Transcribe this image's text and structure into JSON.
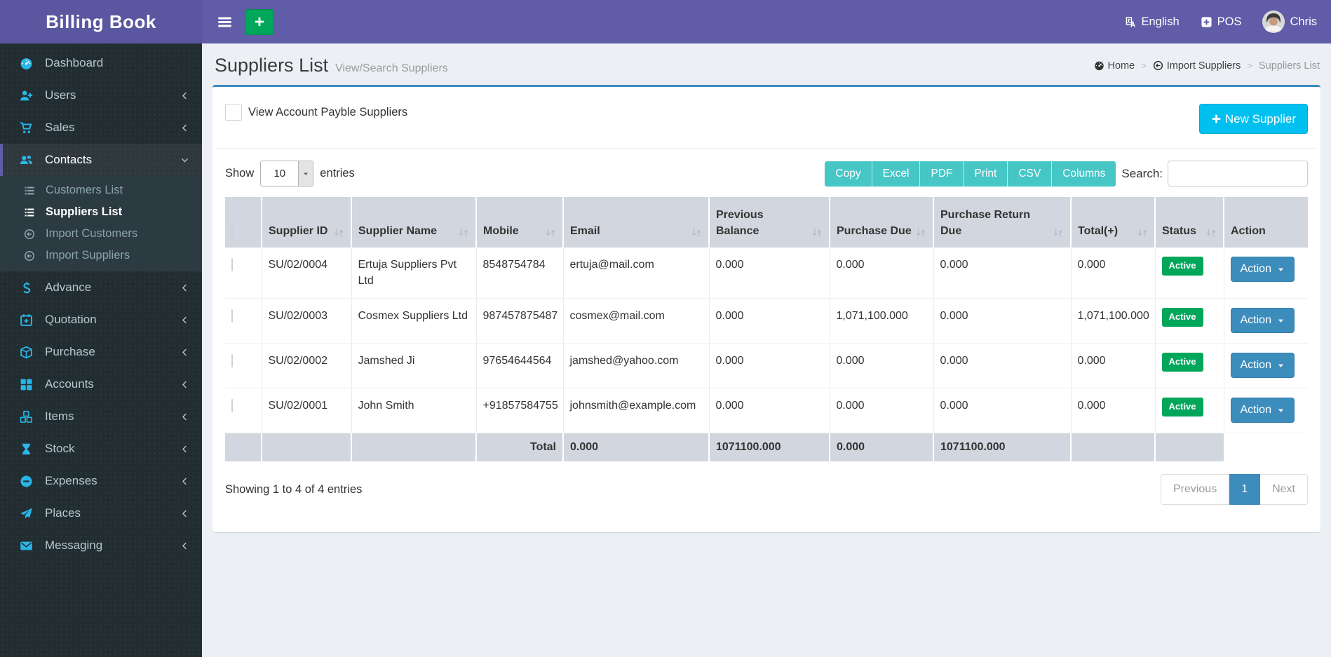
{
  "brand": {
    "title": "Billing Book"
  },
  "navbar": {
    "language": "English",
    "pos": "POS",
    "user": "Chris"
  },
  "sidebar": {
    "items": [
      {
        "label": "Dashboard",
        "icon": "gauge",
        "chevron": null,
        "active": false
      },
      {
        "label": "Users",
        "icon": "user-plus",
        "chevron": "left",
        "active": false
      },
      {
        "label": "Sales",
        "icon": "cart",
        "chevron": "left",
        "active": false
      },
      {
        "label": "Contacts",
        "icon": "users",
        "chevron": "down",
        "active": true,
        "children": [
          {
            "label": "Customers List",
            "icon": "list",
            "active": false
          },
          {
            "label": "Suppliers List",
            "icon": "list",
            "active": true
          },
          {
            "label": "Import Customers",
            "icon": "import",
            "active": false
          },
          {
            "label": "Import Suppliers",
            "icon": "import",
            "active": false
          }
        ]
      },
      {
        "label": "Advance",
        "icon": "dollar",
        "chevron": "left",
        "active": false
      },
      {
        "label": "Quotation",
        "icon": "calendar-plus",
        "chevron": "left",
        "active": false
      },
      {
        "label": "Purchase",
        "icon": "cube",
        "chevron": "left",
        "active": false
      },
      {
        "label": "Accounts",
        "icon": "grid",
        "chevron": "left",
        "active": false
      },
      {
        "label": "Items",
        "icon": "cubes",
        "chevron": "left",
        "active": false
      },
      {
        "label": "Stock",
        "icon": "hourglass",
        "chevron": "left",
        "active": false
      },
      {
        "label": "Expenses",
        "icon": "minus-circle",
        "chevron": "left",
        "active": false
      },
      {
        "label": "Places",
        "icon": "paper-plane",
        "chevron": "left",
        "active": false
      },
      {
        "label": "Messaging",
        "icon": "envelope",
        "chevron": "left",
        "active": false
      }
    ]
  },
  "page": {
    "title": "Suppliers List",
    "subtitle": "View/Search Suppliers",
    "breadcrumb": [
      {
        "label": "Home",
        "icon": "gauge",
        "current": false
      },
      {
        "label": "Import Suppliers",
        "icon": "import",
        "current": false
      },
      {
        "label": "Suppliers List",
        "icon": null,
        "current": true
      }
    ]
  },
  "main": {
    "filter_label": "View Account Payble Suppliers",
    "new_supplier_label": "New Supplier",
    "show_label": "Show",
    "page_size": "10",
    "entries_label": "entries",
    "export_buttons": [
      "Copy",
      "Excel",
      "PDF",
      "Print",
      "CSV",
      "Columns"
    ],
    "search_label": "Search:",
    "search_value": "",
    "table": {
      "columns": [
        {
          "label": "Supplier ID",
          "key": "id",
          "sortable": true
        },
        {
          "label": "Supplier Name",
          "key": "name",
          "sortable": true
        },
        {
          "label": "Mobile",
          "key": "mobile",
          "sortable": true
        },
        {
          "label": "Email",
          "key": "email",
          "sortable": true
        },
        {
          "label": "Previous Balance",
          "key": "prev",
          "sortable": true
        },
        {
          "label": "Purchase Due",
          "key": "due",
          "sortable": true
        },
        {
          "label": "Purchase Return Due",
          "key": "ret",
          "sortable": true
        },
        {
          "label": "Total(+)",
          "key": "total",
          "sortable": true
        },
        {
          "label": "Status",
          "key": "status",
          "sortable": true
        },
        {
          "label": "Action",
          "key": "action",
          "sortable": false
        }
      ],
      "rows": [
        {
          "id": "SU/02/0004",
          "name": "Ertuja Suppliers Pvt Ltd",
          "mobile": "8548754784",
          "email": "ertuja@mail.com",
          "prev": "0.000",
          "due": "0.000",
          "ret": "0.000",
          "total": "0.000",
          "status": "Active",
          "action": "Action"
        },
        {
          "id": "SU/02/0003",
          "name": "Cosmex Suppliers Ltd",
          "mobile": "987457875487",
          "email": "cosmex@mail.com",
          "prev": "0.000",
          "due": "1,071,100.000",
          "ret": "0.000",
          "total": "1,071,100.000",
          "status": "Active",
          "action": "Action"
        },
        {
          "id": "SU/02/0002",
          "name": "Jamshed Ji",
          "mobile": "97654644564",
          "email": "jamshed@yahoo.com",
          "prev": "0.000",
          "due": "0.000",
          "ret": "0.000",
          "total": "0.000",
          "status": "Active",
          "action": "Action"
        },
        {
          "id": "SU/02/0001",
          "name": "John Smith",
          "mobile": "+91857584755",
          "email": "johnsmith@example.com",
          "prev": "0.000",
          "due": "0.000",
          "ret": "0.000",
          "total": "0.000",
          "status": "Active",
          "action": "Action"
        }
      ],
      "footer": {
        "label": "Total",
        "prev": "0.000",
        "due": "1071100.000",
        "ret": "0.000",
        "total": "1071100.000"
      }
    },
    "info_text": "Showing 1 to 4 of 4 entries",
    "pagination": {
      "previous": "Previous",
      "page": "1",
      "next": "Next"
    }
  },
  "colors": {
    "header": "#605ca8",
    "sidebar": "#222d32",
    "accent_info": "#00c0ef",
    "accent_success": "#00a65a",
    "accent_primary": "#3c8dbc",
    "export_button": "#47c6c6",
    "table_head": "#d2d6de",
    "icon_blue": "#29b6e8"
  }
}
